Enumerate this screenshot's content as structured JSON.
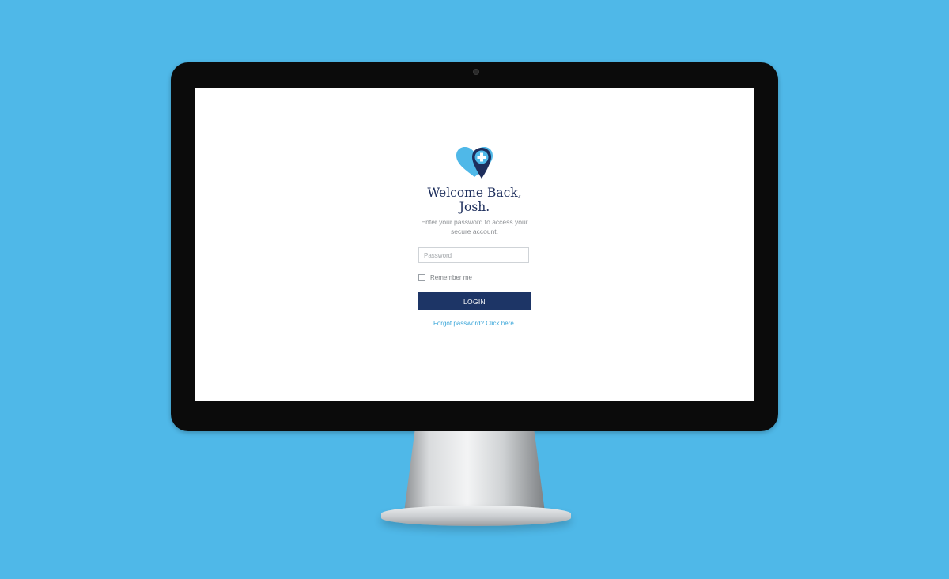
{
  "colors": {
    "background": "#4fb8e8",
    "brand_navy": "#1d2e5c",
    "button": "#1d3566",
    "link": "#3aa6d9",
    "logo_light_blue": "#4fb8e8"
  },
  "logo": {
    "icon": "heart-location-pin-medical-cross-icon"
  },
  "login": {
    "title_line1": "Welcome Back,",
    "title_line2": "Josh.",
    "subtitle_line1": "Enter your password to access your",
    "subtitle_line2": "secure account.",
    "password_placeholder": "Password",
    "remember_label": "Remember me",
    "login_button": "LOGIN",
    "forgot_link": "Forgot password? Click here."
  }
}
